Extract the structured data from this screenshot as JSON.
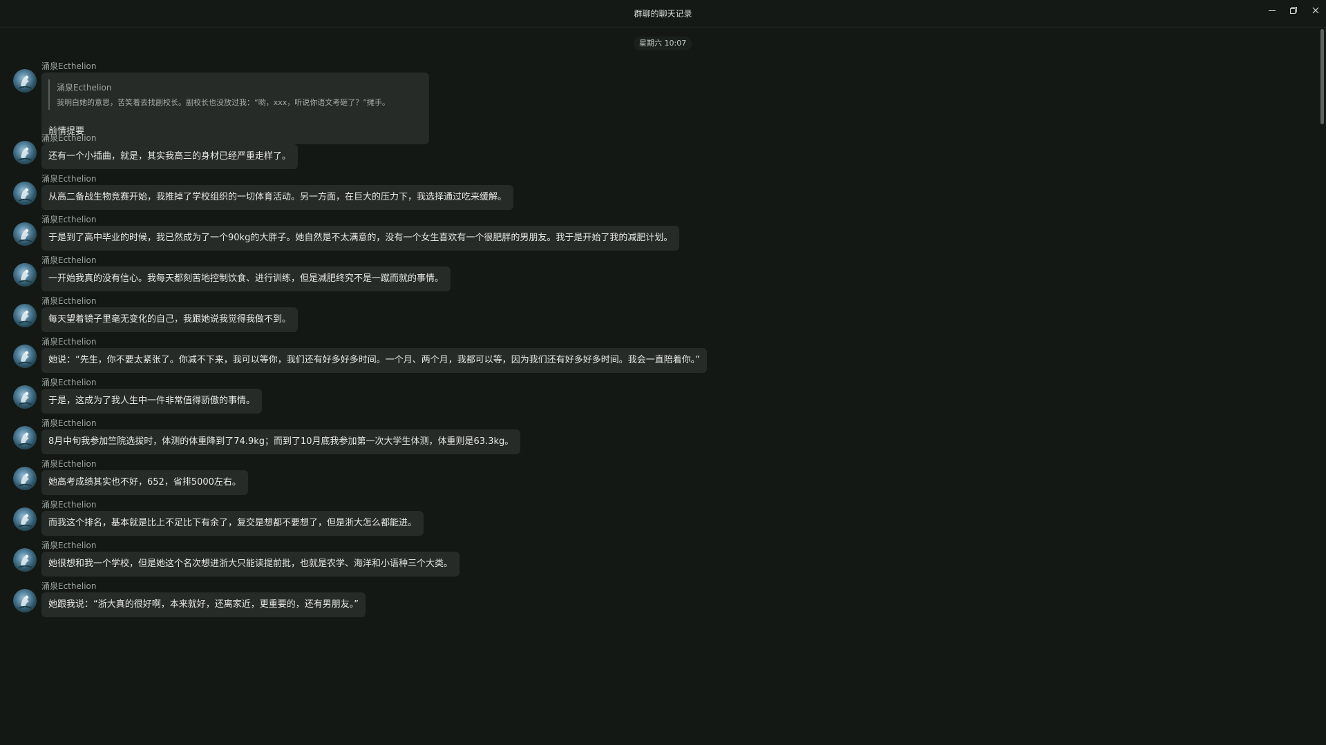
{
  "window": {
    "title": "群聊的聊天记录"
  },
  "timestamp": "星期六 10:07",
  "quote_message": {
    "sender": "涌泉Ecthelion",
    "quoted_sender": "涌泉Ecthelion",
    "quoted_text": "我明白她的意思，苦笑着去找副校长。副校长也没放过我：“哟，xxx，听说你语文考砸了？”摊手。",
    "text": "前情提要"
  },
  "messages": [
    {
      "sender": "涌泉Ecthelion",
      "text": "还有一个小插曲，就是，其实我高三的身材已经严重走样了。"
    },
    {
      "sender": "涌泉Ecthelion",
      "text": "从高二备战生物竞赛开始，我推掉了学校组织的一切体育活动。另一方面，在巨大的压力下，我选择通过吃来缓解。"
    },
    {
      "sender": "涌泉Ecthelion",
      "text": "于是到了高中毕业的时候，我已然成为了一个90kg的大胖子。她自然是不太满意的，没有一个女生喜欢有一个很肥胖的男朋友。我于是开始了我的减肥计划。"
    },
    {
      "sender": "涌泉Ecthelion",
      "text": "一开始我真的没有信心。我每天都刻苦地控制饮食、进行训练，但是减肥终究不是一蹴而就的事情。"
    },
    {
      "sender": "涌泉Ecthelion",
      "text": "每天望着镜子里毫无变化的自己，我跟她说我觉得我做不到。"
    },
    {
      "sender": "涌泉Ecthelion",
      "text": "她说：“先生，你不要太紧张了。你减不下来，我可以等你，我们还有好多好多时间。一个月、两个月，我都可以等，因为我们还有好多好多时间。我会一直陪着你。”"
    },
    {
      "sender": "涌泉Ecthelion",
      "text": "于是，这成为了我人生中一件非常值得骄傲的事情。"
    },
    {
      "sender": "涌泉Ecthelion",
      "text": "8月中旬我参加竺院选拔时，体测的体重降到了74.9kg；而到了10月底我参加第一次大学生体测，体重则是63.3kg。"
    },
    {
      "sender": "涌泉Ecthelion",
      "text": "她高考成绩其实也不好，652，省排5000左右。"
    },
    {
      "sender": "涌泉Ecthelion",
      "text": "而我这个排名，基本就是比上不足比下有余了，复交是想都不要想了，但是浙大怎么都能进。"
    },
    {
      "sender": "涌泉Ecthelion",
      "text": "她很想和我一个学校，但是她这个名次想进浙大只能读提前批，也就是农学、海洋和小语种三个大类。"
    },
    {
      "sender": "涌泉Ecthelion",
      "text": "她跟我说：“浙大真的很好啊，本来就好，还离家近，更重要的，还有男朋友。”"
    }
  ],
  "icons": {
    "minimize": "minimize-icon",
    "restore": "restore-icon",
    "close": "close-icon",
    "avatar": "avatar-icon"
  },
  "colors": {
    "background": "#131815",
    "bubble": "#262b28",
    "text": "#e6e9e7",
    "sender": "#9aa39e"
  }
}
